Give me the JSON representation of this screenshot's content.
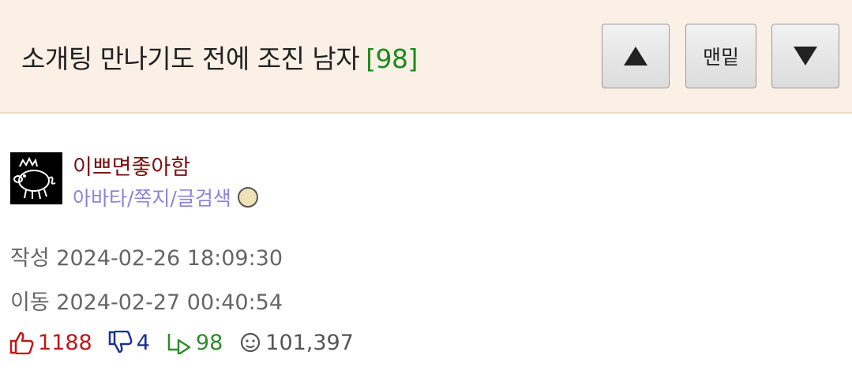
{
  "header": {
    "title": "소개팅 만나기도 전에 조진 남자",
    "comment_count": "[98]",
    "bottom_button_label": "맨밑",
    "up_icon": "arrow-up-icon",
    "down_icon": "arrow-down-icon"
  },
  "post": {
    "author": "이쁘면좋아함",
    "author_links": "아바타/쪽지/글검색",
    "avatar_icon": "pig-avatar",
    "badge_icon": "medal-badge-icon",
    "created_label": "작성",
    "created_at": "2024-02-26 18:09:30",
    "moved_label": "이동",
    "moved_at": "2024-02-27 00:40:54"
  },
  "stats": {
    "likes": "1188",
    "dislikes": "4",
    "replies": "98",
    "views": "101,397"
  },
  "colors": {
    "header_bg": "#faf0e6",
    "author": "#7a1010",
    "links": "#8a84d8",
    "comment_count": "#1e8a1e",
    "likes": "#c01818",
    "dislikes": "#1a2f9a",
    "replies": "#2d8a2d"
  }
}
